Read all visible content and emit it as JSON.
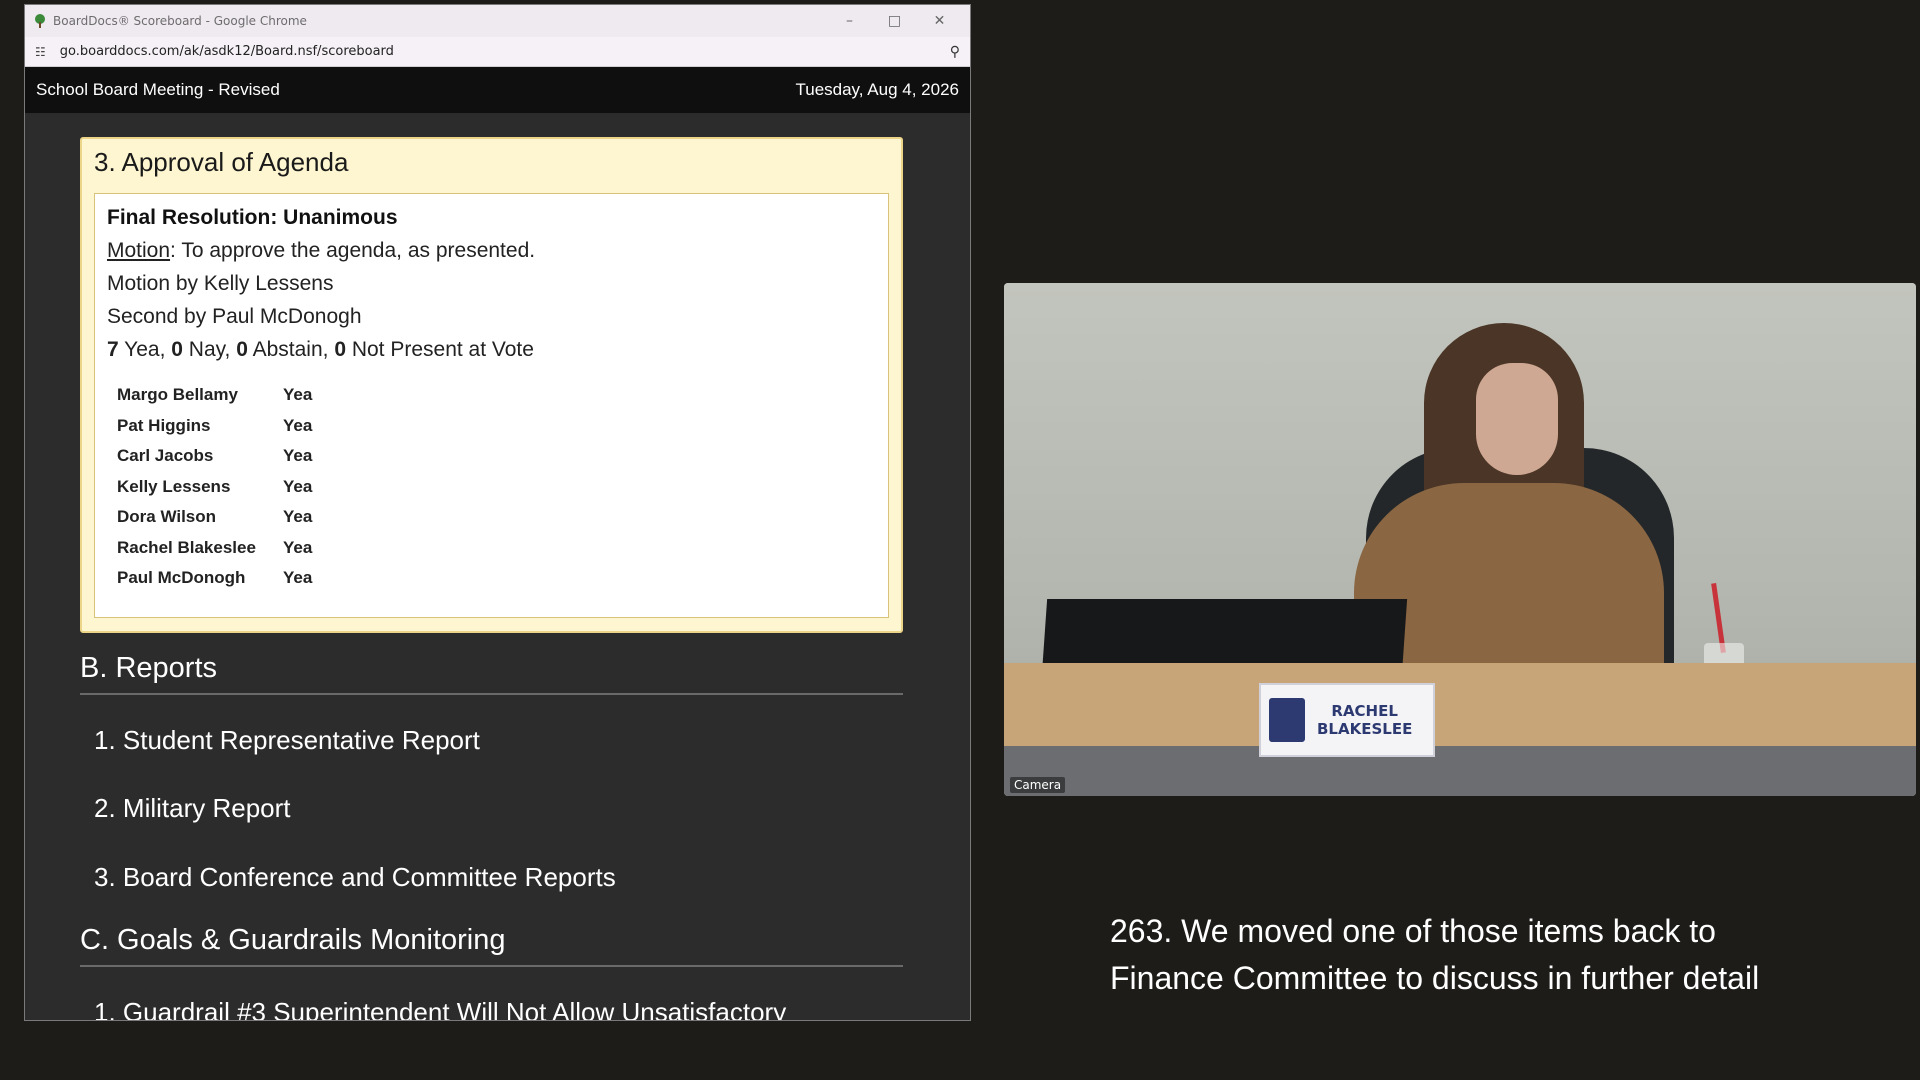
{
  "window": {
    "title": "BoardDocs® Scoreboard - Google Chrome",
    "url": "go.boarddocs.com/ak/asdk12/Board.nsf/scoreboard"
  },
  "header": {
    "meeting": "School Board Meeting - Revised",
    "date": "Tuesday, Aug 4, 2026"
  },
  "agenda_item": {
    "title": "3. Approval of Agenda",
    "resolution": "Final Resolution: Unanimous",
    "motion_label": "Motion",
    "motion_text": ": To approve the agenda, as presented.",
    "motion_by": "Motion by Kelly Lessens",
    "second_by": "Second by Paul McDonogh",
    "tally": {
      "yea": "7",
      "yea_label": " Yea, ",
      "nay": "0",
      "nay_label": " Nay, ",
      "abstain": "0",
      "abstain_label": " Abstain, ",
      "not_present": "0",
      "not_present_label": " Not Present at Vote"
    },
    "votes": [
      {
        "name": "Margo Bellamy",
        "vote": "Yea"
      },
      {
        "name": "Pat Higgins",
        "vote": "Yea"
      },
      {
        "name": "Carl Jacobs",
        "vote": "Yea"
      },
      {
        "name": "Kelly Lessens",
        "vote": "Yea"
      },
      {
        "name": "Dora Wilson",
        "vote": "Yea"
      },
      {
        "name": "Rachel Blakeslee",
        "vote": "Yea"
      },
      {
        "name": "Paul McDonogh",
        "vote": "Yea"
      }
    ]
  },
  "sections": [
    {
      "heading": "B. Reports",
      "items": [
        "1. Student Representative Report",
        "2. Military Report",
        "3. Board Conference and Committee Reports"
      ]
    },
    {
      "heading": "C. Goals & Guardrails Monitoring",
      "items": [
        "1. Guardrail #3 Superintendent Will Not Allow Unsatisfactory"
      ]
    }
  ],
  "video": {
    "nameplate_line1": "RACHEL",
    "nameplate_line2": "BLAKESLEE",
    "camera_label": "Camera"
  },
  "caption": {
    "line1": "263. We moved one of those items back to",
    "line2": "Finance Committee to discuss in further detail"
  }
}
